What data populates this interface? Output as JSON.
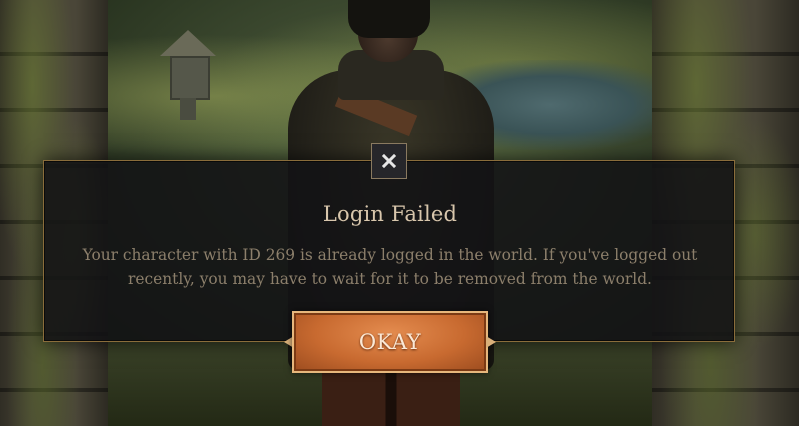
{
  "dialog": {
    "title": "Login Failed",
    "message": "Your character with ID 269 is already logged in the world. If you've logged out recently, you may have to wait for it to be removed from the world.",
    "close_icon": "close-x-icon",
    "okay_label": "OKAY"
  },
  "colors": {
    "title": "#d8c6ac",
    "message": "#8c7f6b",
    "dialog_border": "#8a6d3b",
    "button_orange": "#c86a30"
  }
}
